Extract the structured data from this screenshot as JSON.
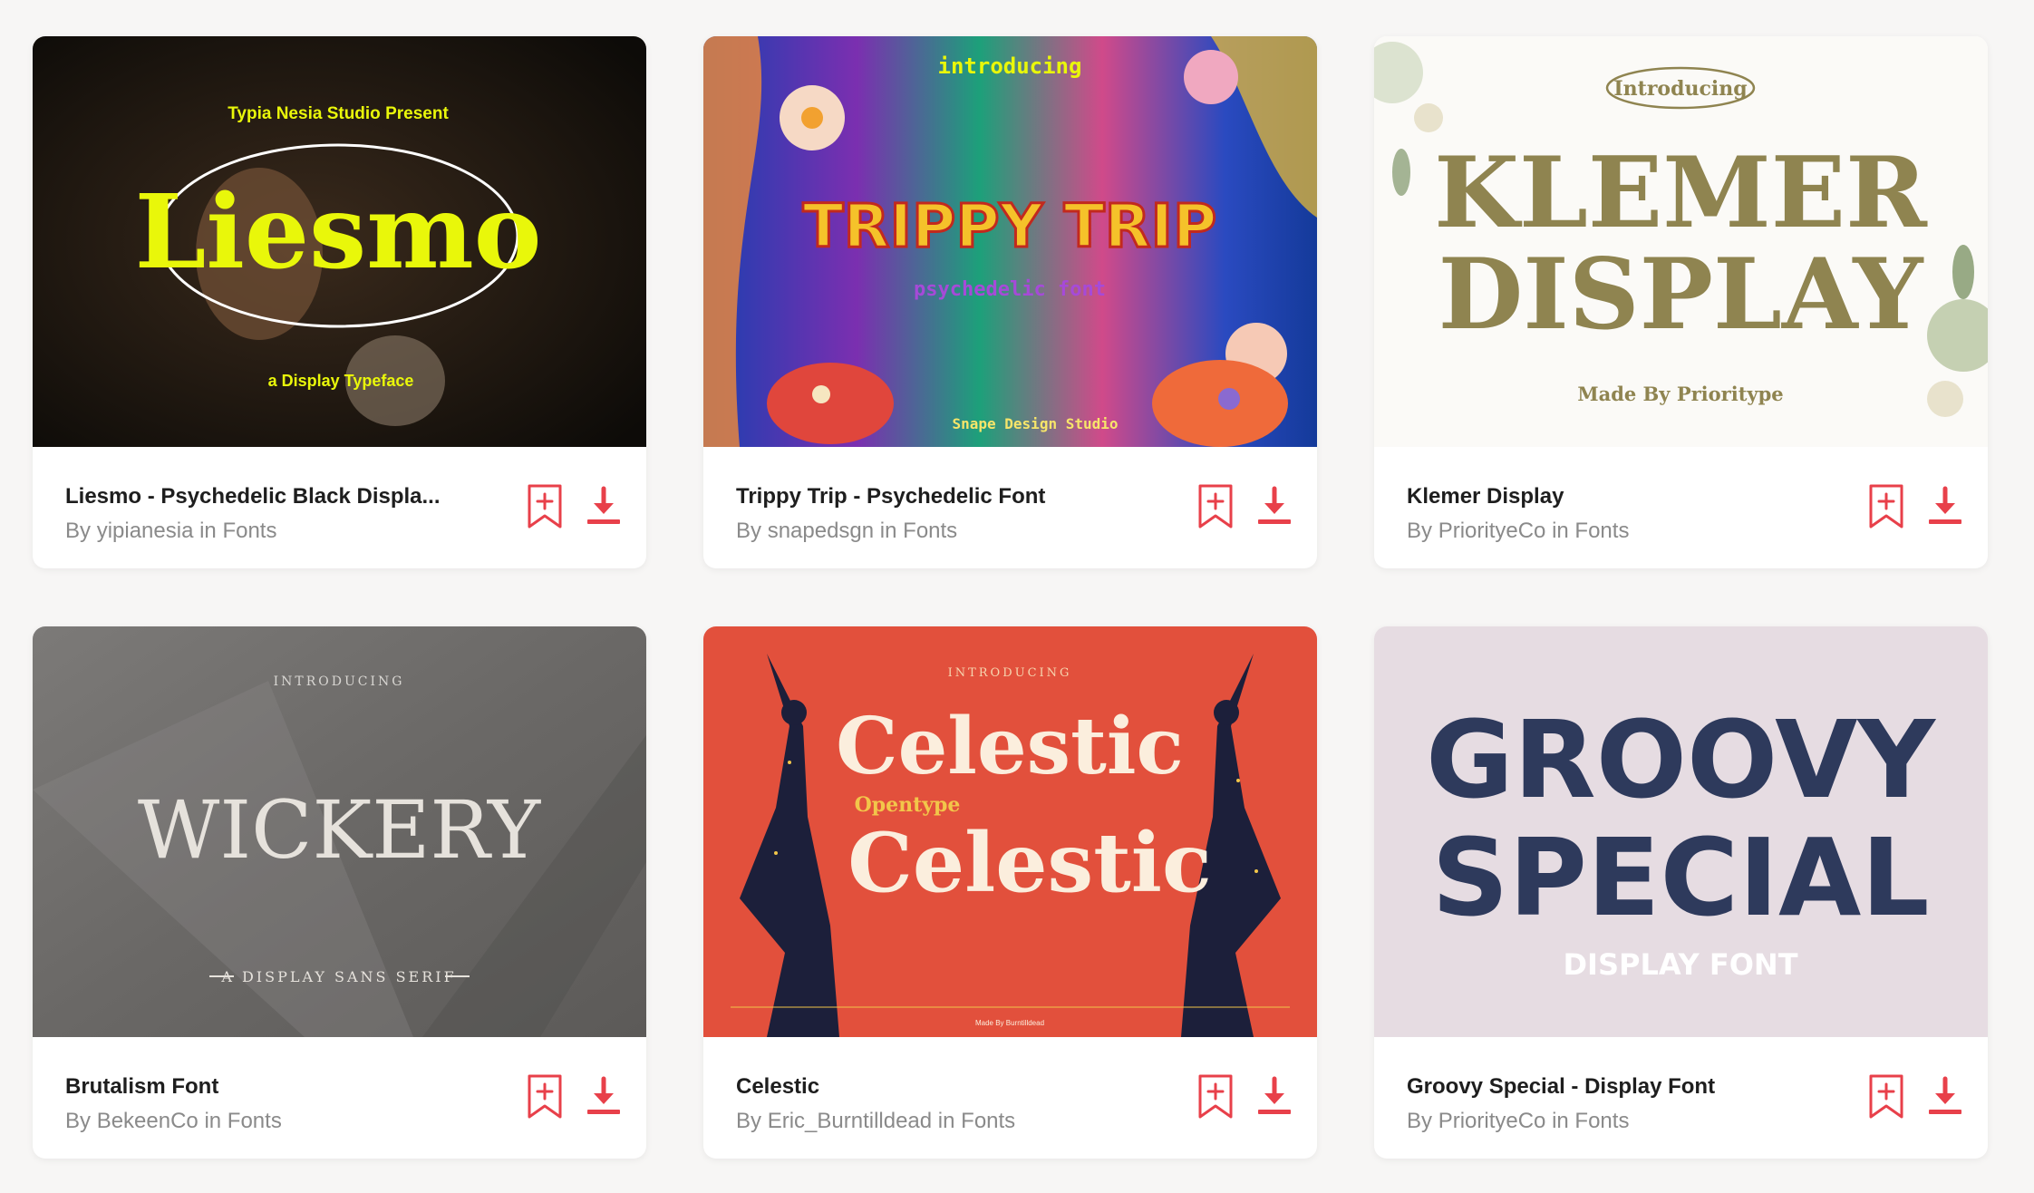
{
  "colors": {
    "accent": "#e8404a",
    "title": "#1e1e1e",
    "meta": "#8a8a8a"
  },
  "cards": [
    {
      "title": "Liesmo - Psychedelic Black Displa...",
      "author": "yipianesia",
      "category": "Fonts",
      "by_prefix": "By",
      "in_word": "in",
      "thumb": {
        "kicker": "Typia Nesia Studio Present",
        "name": "Liesmo",
        "sub": "a Display Typeface"
      }
    },
    {
      "title": "Trippy Trip - Psychedelic Font",
      "author": "snapedsgn",
      "category": "Fonts",
      "by_prefix": "By",
      "in_word": "in",
      "thumb": {
        "kicker": "introducing",
        "name": "TRIPPY TRIP",
        "sub": "psychedelic font",
        "footer": "Snape Design Studio"
      }
    },
    {
      "title": "Klemer Display",
      "author": "PriorityeCo",
      "category": "Fonts",
      "by_prefix": "By",
      "in_word": "in",
      "thumb": {
        "kicker": "Introducing",
        "name_line1": "KLEMER",
        "name_line2": "DISPLAY",
        "footer": "Made By Prioritype"
      }
    },
    {
      "title": "Brutalism Font",
      "author": "BekeenCo",
      "category": "Fonts",
      "by_prefix": "By",
      "in_word": "in",
      "thumb": {
        "kicker": "INTRODUCING",
        "name": "WICKERY",
        "sub": "A DISPLAY SANS SERIF"
      }
    },
    {
      "title": "Celestic",
      "author": "Eric_Burntilldead",
      "category": "Fonts",
      "by_prefix": "By",
      "in_word": "in",
      "thumb": {
        "kicker": "INTRODUCING",
        "name": "Celestic",
        "sub": "Opentype",
        "name2": "Celestic",
        "footer": "Made By Burntilldead"
      }
    },
    {
      "title": "Groovy Special - Display Font",
      "author": "PriorityeCo",
      "category": "Fonts",
      "by_prefix": "By",
      "in_word": "in",
      "thumb": {
        "name_line1": "GROOVY",
        "name_line2": "SPECIAL",
        "sub": "DISPLAY FONT"
      }
    }
  ]
}
